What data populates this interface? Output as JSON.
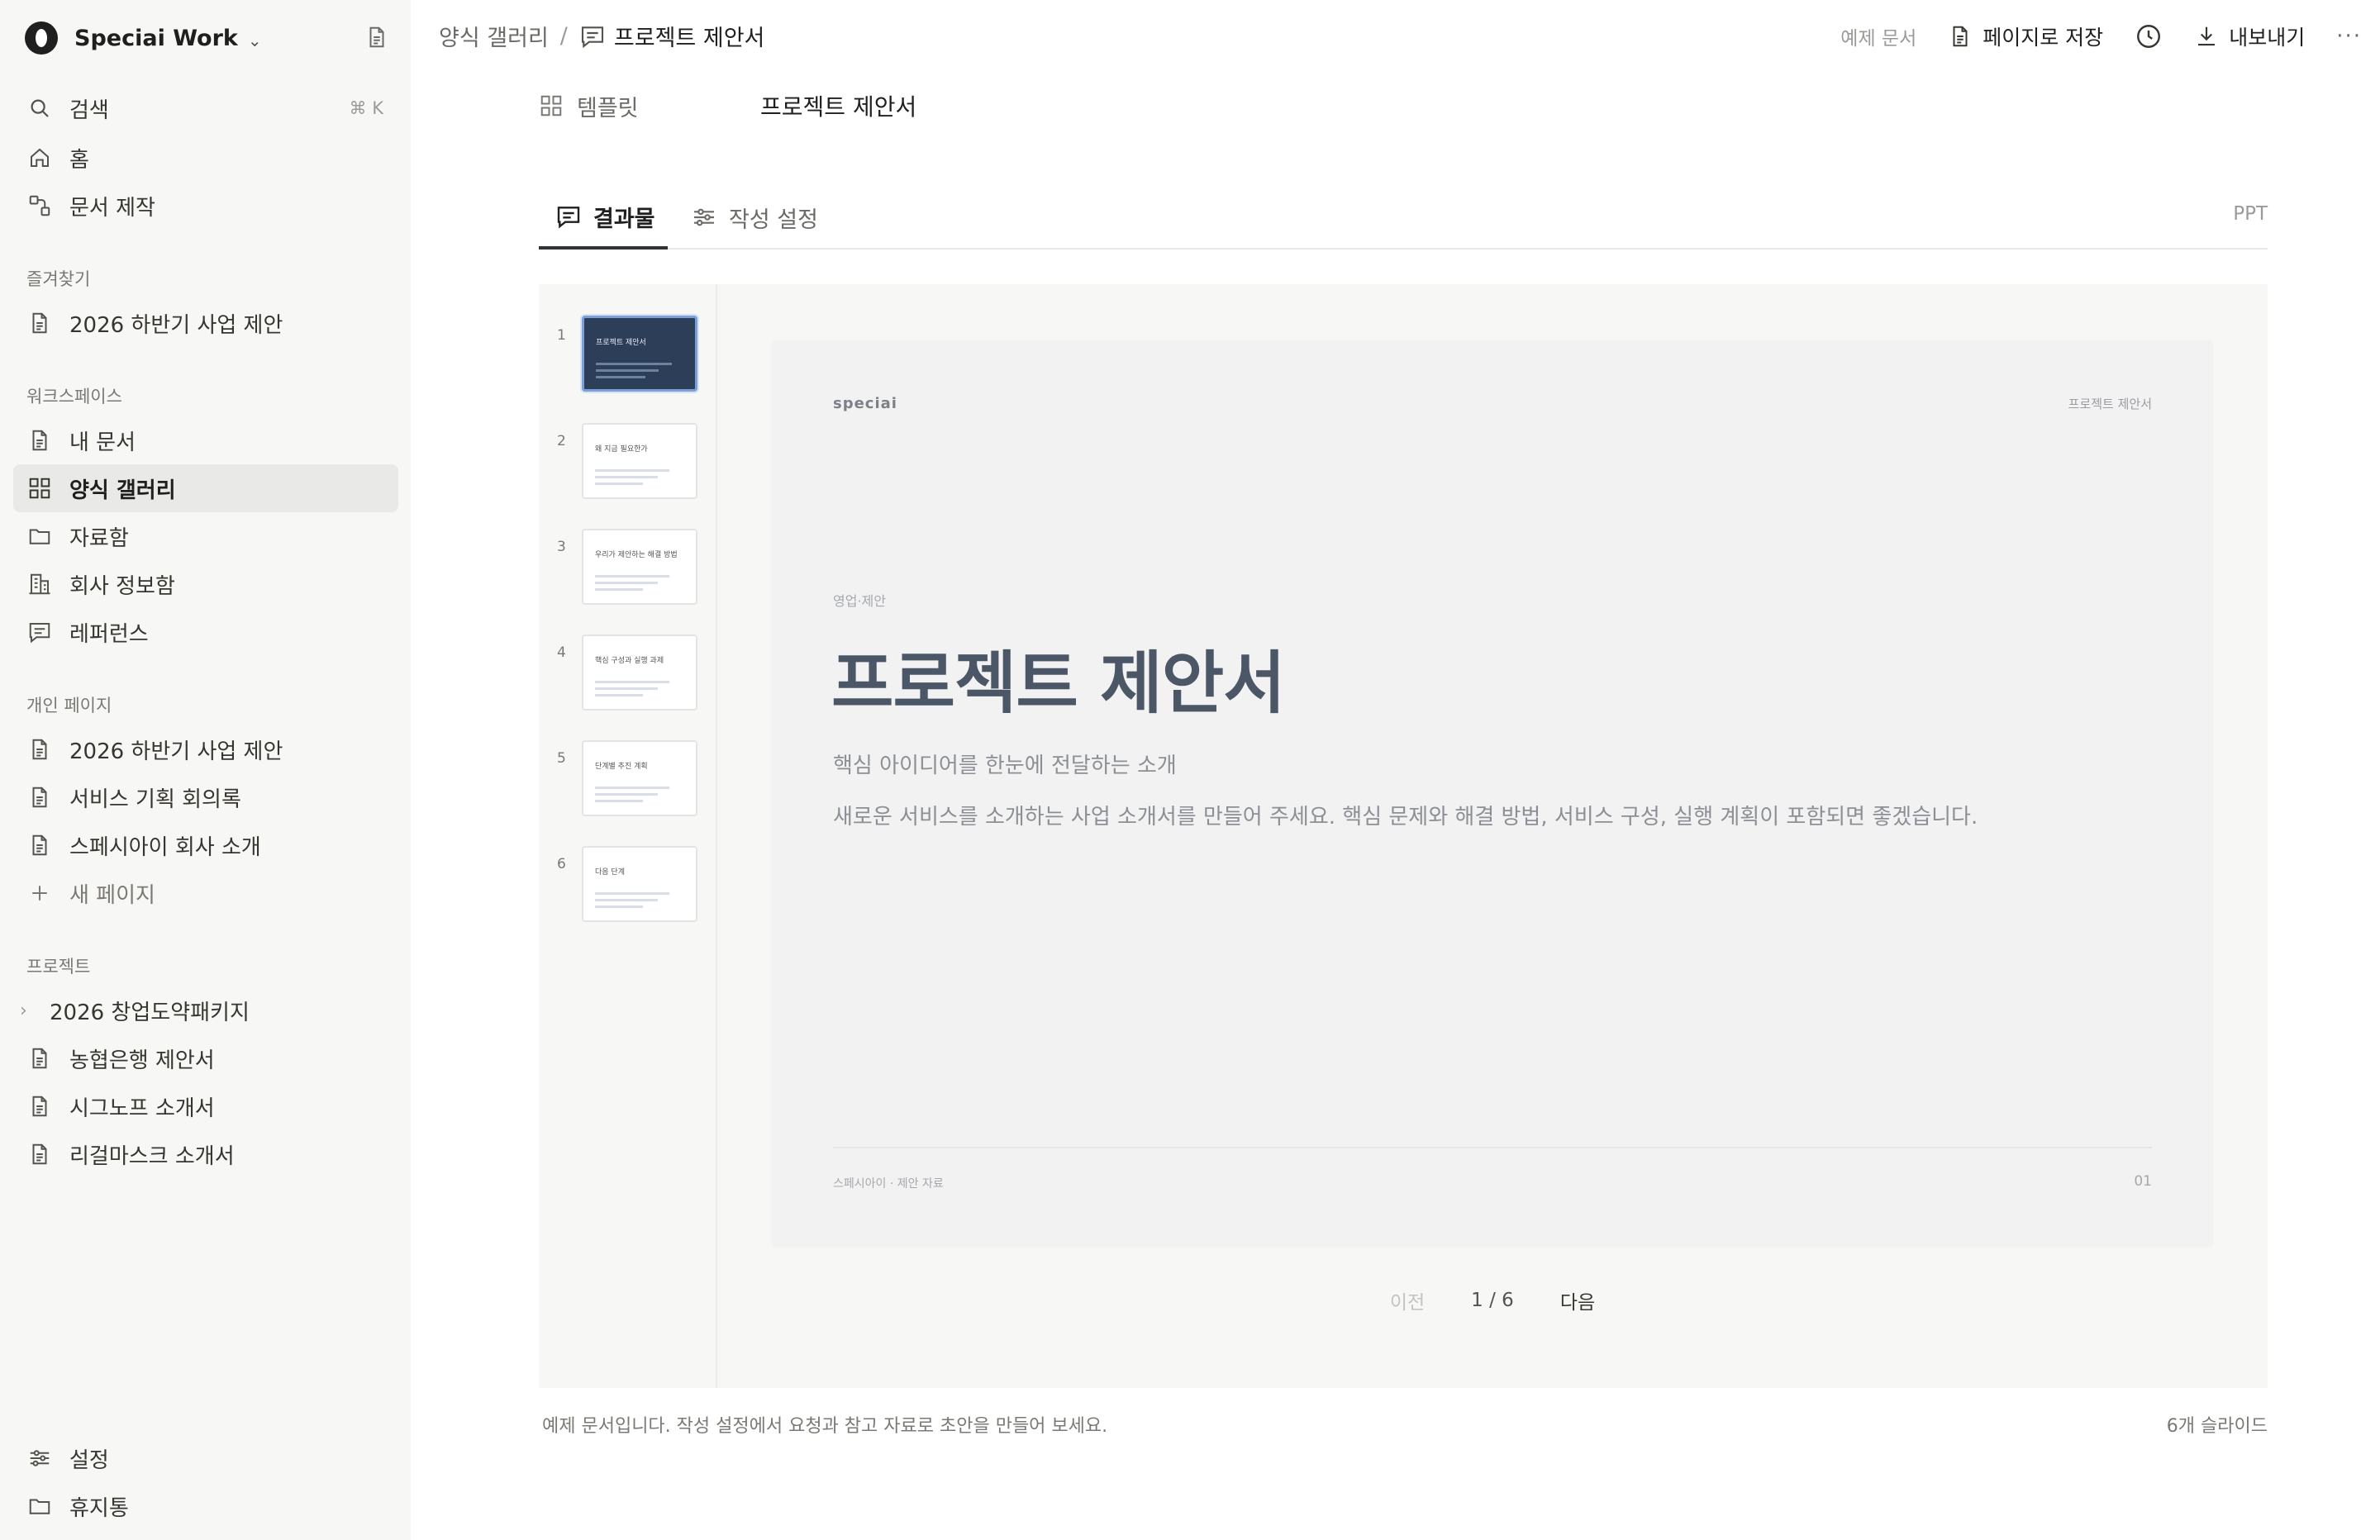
{
  "workspace": {
    "name": "Speciai Work"
  },
  "sidebar": {
    "search": {
      "label": "검색",
      "shortcut": "⌘ K"
    },
    "home": "홈",
    "create": "문서 제작",
    "favorites": {
      "title": "즐겨찾기",
      "items": [
        "2026 하반기 사업 제안"
      ]
    },
    "workspace_section": {
      "title": "워크스페이스",
      "items": [
        "내 문서",
        "양식 갤러리",
        "자료함",
        "회사 정보함",
        "레퍼런스"
      ]
    },
    "personal": {
      "title": "개인 페이지",
      "items": [
        "2026 하반기 사업 제안",
        "서비스 기획 회의록",
        "스페시아이 회사 소개"
      ],
      "new_page": "새 페이지"
    },
    "projects": {
      "title": "프로젝트",
      "items": [
        "2026 창업도약패키지",
        "농협은행 제안서",
        "시그노프 소개서",
        "리걸마스크 소개서"
      ]
    },
    "settings": "설정",
    "trash": "휴지통"
  },
  "header": {
    "breadcrumb": [
      "양식 갤러리",
      "프로젝트 제안서"
    ],
    "example_label": "예제 문서",
    "save_label": "페이지로 저장",
    "export_label": "내보내기",
    "more_label": "···"
  },
  "template": {
    "label": "템플릿",
    "value": "프로젝트 제안서"
  },
  "tabs": {
    "result": "결과물",
    "settings": "작성 설정",
    "format": "PPT"
  },
  "thumbnails": [
    {
      "num": "1",
      "title": "프로젝트 제안서"
    },
    {
      "num": "2",
      "title": "왜 지금 필요한가"
    },
    {
      "num": "3",
      "title": "우리가 제안하는 해결 방법"
    },
    {
      "num": "4",
      "title": "핵심 구성과 실행 과제"
    },
    {
      "num": "5",
      "title": "단계별 추진 계획"
    },
    {
      "num": "6",
      "title": "다음 단계"
    }
  ],
  "slide": {
    "brand": "speciai",
    "header_right": "프로젝트 제안서",
    "eyebrow": "영업·제안",
    "title": "프로젝트 제안서",
    "subtitle": "핵심 아이디어를 한눈에 전달하는 소개",
    "body": "새로운 서비스를 소개하는 사업 소개서를 만들어 주세요. 핵심 문제와 해결 방법, 서비스 구성, 실행 계획이 포함되면 좋겠습니다.",
    "footer_left": "스페시아이 · 제안 자료",
    "footer_right": "01"
  },
  "pager": {
    "prev": "이전",
    "current": "1 / 6",
    "next": "다음"
  },
  "footer": {
    "note": "예제 문서입니다. 작성 설정에서 요청과 참고 자료로 초안을 만들어 보세요.",
    "count": "6개 슬라이드"
  },
  "colors": {
    "sidebar_bg": "#f7f7f5",
    "active_item": "#e9e9e7",
    "slide_title": "#4b5667",
    "thumb_active": "#2c3e58"
  }
}
